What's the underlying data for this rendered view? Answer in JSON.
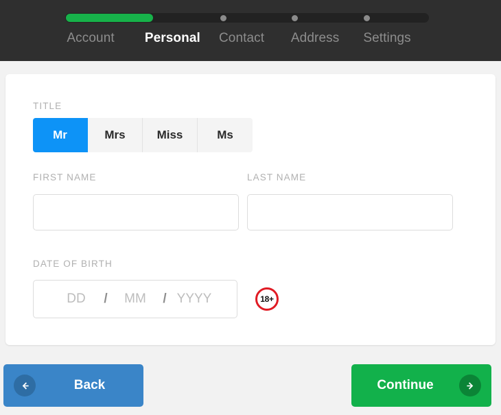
{
  "header": {
    "progress": {
      "fill_percent": 24,
      "dots": [
        {
          "name": "step-dot-contact",
          "x_percent": 43.4
        },
        {
          "name": "step-dot-address",
          "x_percent": 63.2
        },
        {
          "name": "step-dot-settings",
          "x_percent": 83.0
        }
      ],
      "fill_color": "#17b24a",
      "track_color": "#222222",
      "dot_color": "#8b8b8b"
    },
    "steps": [
      {
        "label": "Account",
        "active": false,
        "x_percent": 7.0
      },
      {
        "label": "Personal",
        "active": true,
        "x_percent": 29.5
      },
      {
        "label": "Contact",
        "active": false,
        "x_percent": 48.5
      },
      {
        "label": "Address",
        "active": false,
        "x_percent": 68.7
      },
      {
        "label": "Settings",
        "active": false,
        "x_percent": 88.5
      }
    ]
  },
  "form": {
    "title": {
      "label": "TITLE",
      "options": [
        "Mr",
        "Mrs",
        "Miss",
        "Ms"
      ],
      "selected": "Mr",
      "selected_color": "#0d93f7"
    },
    "first_name": {
      "label": "FIRST NAME",
      "value": "",
      "placeholder": ""
    },
    "last_name": {
      "label": "LAST NAME",
      "value": "",
      "placeholder": ""
    },
    "date_of_birth": {
      "label": "DATE OF BIRTH",
      "day_placeholder": "DD",
      "month_placeholder": "MM",
      "year_placeholder": "YYYY",
      "separator": "/",
      "day_value": "",
      "month_value": "",
      "year_value": "",
      "age_badge": "18+",
      "age_badge_color": "#e01b24"
    }
  },
  "footer": {
    "back_label": "Back",
    "back_color": "#3a85c8",
    "continue_label": "Continue",
    "continue_color": "#12b14b"
  }
}
